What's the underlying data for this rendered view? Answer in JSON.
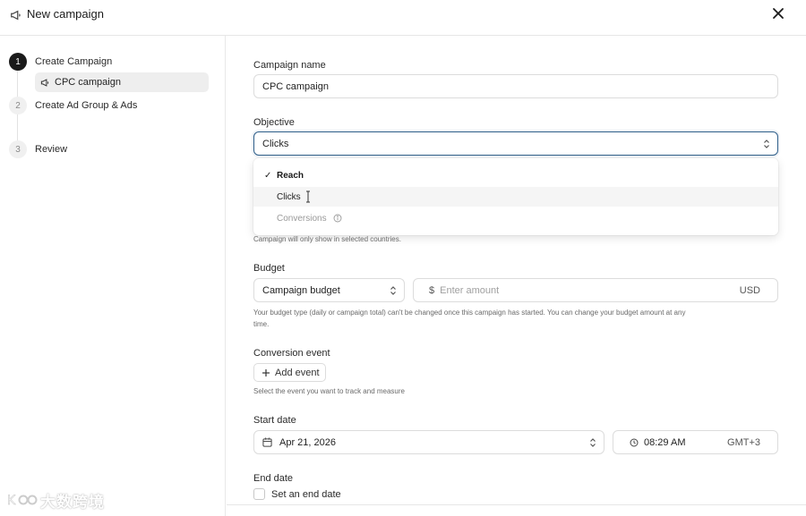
{
  "header": {
    "title": "New campaign",
    "title_icon": "megaphone-icon",
    "close_icon": "close-icon"
  },
  "steps": [
    {
      "number": "1",
      "label": "Create Campaign",
      "active": true
    },
    {
      "number": "2",
      "label": "Create Ad Group & Ads",
      "active": false
    },
    {
      "number": "3",
      "label": "Review",
      "active": false
    }
  ],
  "substep": {
    "label": "CPC campaign",
    "icon": "megaphone-icon"
  },
  "form": {
    "campaign_name": {
      "label": "Campaign name",
      "value": "CPC campaign"
    },
    "objective": {
      "label": "Objective",
      "value": "Clicks",
      "options": [
        {
          "label": "Reach",
          "checked": true
        },
        {
          "label": "Clicks",
          "hovered": true
        },
        {
          "label": "Conversions",
          "disabled": true
        }
      ]
    },
    "countries_help": "Campaign will only show in selected countries.",
    "budget": {
      "label": "Budget",
      "type_value": "Campaign budget",
      "currency_symbol": "$",
      "amount_placeholder": "Enter amount",
      "currency": "USD",
      "help_line1": "Your budget type (daily or campaign total) can't be changed once this campaign has started. You can change your budget amount at any",
      "help_line2": "time."
    },
    "conversion_event": {
      "label": "Conversion event",
      "button": "Add event",
      "help": "Select the event you want to track and measure"
    },
    "start_date": {
      "label": "Start date",
      "date": "Apr 21, 2026",
      "time": "08:29 AM",
      "timezone": "GMT+3"
    },
    "end_date": {
      "label": "End date",
      "checkbox_label": "Set an end date"
    }
  },
  "watermark": {
    "text": "大数跨境"
  },
  "colors": {
    "focus_border": "#2f5f8a",
    "active_step": "#1a1a1a"
  }
}
